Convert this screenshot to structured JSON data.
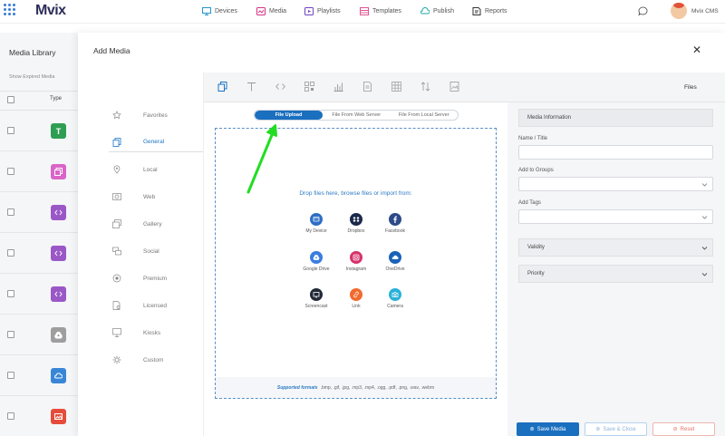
{
  "app": {
    "logo": "Mvix",
    "user_name": "Mvix CMS"
  },
  "nav": {
    "items": [
      {
        "label": "Devices",
        "icon": "monitor-icon",
        "color": "#2196c9"
      },
      {
        "label": "Media",
        "icon": "media-icon",
        "color": "#d63384"
      },
      {
        "label": "Playlists",
        "icon": "playlist-icon",
        "color": "#6f42c1"
      },
      {
        "label": "Templates",
        "icon": "templates-icon",
        "color": "#e05592"
      },
      {
        "label": "Publish",
        "icon": "publish-icon",
        "color": "#18a9a1"
      },
      {
        "label": "Reports",
        "icon": "reports-icon",
        "color": "#333333"
      }
    ]
  },
  "library": {
    "title": "Media Library",
    "show_expired": "Show Expired Media",
    "type_header": "Type",
    "rows": [
      {
        "icon": "text-icon",
        "color": "#2e9e52"
      },
      {
        "icon": "gallery-icon",
        "color": "#d965c7"
      },
      {
        "icon": "code-icon",
        "color": "#9a58c7"
      },
      {
        "icon": "code-icon",
        "color": "#9a58c7"
      },
      {
        "icon": "code-icon",
        "color": "#9a58c7"
      },
      {
        "icon": "google-drive-icon",
        "color": "#9e9e9e"
      },
      {
        "icon": "cloud-icon",
        "color": "#3a86d6"
      },
      {
        "icon": "image-icon",
        "color": "#e54c3c"
      }
    ]
  },
  "modal": {
    "title": "Add Media",
    "categories": [
      {
        "label": "Favorites",
        "icon": "star-icon"
      },
      {
        "label": "General",
        "icon": "copy-icon",
        "active": true
      },
      {
        "label": "Local",
        "icon": "location-icon"
      },
      {
        "label": "Web",
        "icon": "web-icon"
      },
      {
        "label": "Gallery",
        "icon": "gallery-icon"
      },
      {
        "label": "Social",
        "icon": "social-icon"
      },
      {
        "label": "Premium",
        "icon": "premium-icon"
      },
      {
        "label": "Licensed",
        "icon": "licensed-icon"
      },
      {
        "label": "Kiosks",
        "icon": "kiosk-icon"
      },
      {
        "label": "Custom",
        "icon": "custom-icon"
      }
    ],
    "toolbar_label": "Files",
    "tools": [
      "copy-icon",
      "text-icon",
      "code-icon",
      "qr-icon",
      "chart-icon",
      "document-icon",
      "grid-icon",
      "sort-icon",
      "image-icon"
    ],
    "tabs": [
      {
        "label": "File Upload",
        "active": true
      },
      {
        "label": "File From Web Server"
      },
      {
        "label": "File From Local Server"
      }
    ],
    "drop_text": "Drop files here, browse files or import from:",
    "sources": [
      {
        "label": "My Device",
        "icon": "device-icon",
        "color": "#2f6fc4"
      },
      {
        "label": "Dropbox",
        "icon": "dropbox-icon",
        "color": "#1b2a4a"
      },
      {
        "label": "Facebook",
        "icon": "facebook-icon",
        "color": "#2d4a8a"
      },
      {
        "label": "Google Drive",
        "icon": "google-drive-icon",
        "color": "#3a7de0"
      },
      {
        "label": "Instagram",
        "icon": "instagram-icon",
        "color": "#d6336c"
      },
      {
        "label": "OneDrive",
        "icon": "onedrive-icon",
        "color": "#1a63b8"
      },
      {
        "label": "Screencast",
        "icon": "screencast-icon",
        "color": "#222a38"
      },
      {
        "label": "Link",
        "icon": "link-icon",
        "color": "#f26a2e"
      },
      {
        "label": "Camera",
        "icon": "camera-icon",
        "color": "#2ab1d8"
      }
    ],
    "formats_label": "Supported formats",
    "formats": ".bmp, .gif, .jpg, .mp3, .mp4, .ogg, .pdf, .png, .wav, .webm",
    "info": {
      "header": "Media Information",
      "name_label": "Name / Title",
      "groups_label": "Add to Groups",
      "tags_label": "Add Tags",
      "validity": "Validity",
      "priority": "Priority"
    },
    "buttons": {
      "save": "Save Media",
      "save_close": "Save & Close",
      "reset": "Reset"
    }
  },
  "annotation_color": "#22dd22"
}
